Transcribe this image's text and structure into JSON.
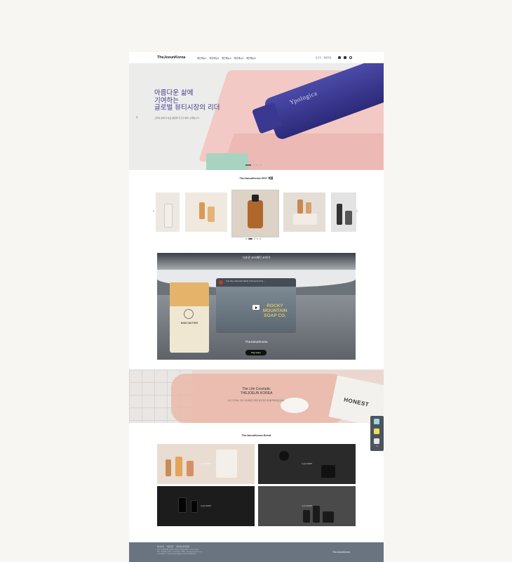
{
  "header": {
    "logo": "TheJoeunKorea",
    "nav": [
      "메인메뉴1",
      "메인메뉴2",
      "메인메뉴3",
      "메인메뉴4",
      "메인메뉴5"
    ],
    "util": [
      "로그인",
      "회원가입"
    ]
  },
  "hero": {
    "headline": [
      "아름다운 삶에",
      "기여하는",
      "글로벌 뷰티시장의 리더"
    ],
    "subtext": "고객의 삶에 더 높은 품질을 추구할 뷰티 소재입니다.",
    "product_text": "Ypologica",
    "slides": 4,
    "active_slide": 1
  },
  "hot": {
    "title": "TheJoeunKorea HOT 제품",
    "pages": 5,
    "active_page": 1
  },
  "video": {
    "title": "더조은 코스메틱 코리아",
    "tabs": [
      "",
      "",
      ""
    ],
    "player_title": "Feel Like a Mountain Watch & Moments at the ...",
    "brand": "ROCKY MOUNTAIN SOAP CO.",
    "product_label": "BODY BUTTER",
    "corp": "TheJoeunKorea",
    "button": "Play Video"
  },
  "banner": {
    "line1": "The Life Cosmetic",
    "line2": "THEJOEUN KOREA",
    "sub": "더조은코리아는 뷰티 소재 제품을 행복한 삶과 좋은 피부를 위해 제공합니다.",
    "product": "HONEST"
  },
  "event": {
    "title": "TheJoeunKorea Event",
    "items": [
      {
        "tag": "더조은 EVENT",
        "bg": "#e8ddd0"
      },
      {
        "tag": "더조은 EVENT",
        "bg": "#2a2a2a"
      },
      {
        "tag": "더조은 EVENT",
        "bg": "#1c1c1c"
      },
      {
        "tag": "더조은 EVENT",
        "bg": "#4a4a4a"
      }
    ]
  },
  "footer": {
    "links": [
      "회사소개",
      "이용약관",
      "개인정보처리방침"
    ],
    "info": [
      "상호 : 더조은코리아 | 대표자 : 홍길동 | 사업자등록번호 : 000-00-00000",
      "주소 : 서울특별시 | 전화 : 02-000-0000 | 이메일 : info@thejoeunkorea.com",
      "COPYRIGHT © THEJOEUNKOREA ALL RIGHTS RESERVED."
    ],
    "logo": "TheJoeunKorea"
  },
  "quickbar": {
    "labels": [
      "",
      "",
      "TOP"
    ]
  },
  "colors": {
    "brand_purple": "#3b3a8d",
    "footer_bg": "#6a7480",
    "page_bg": "#f7f6f3"
  }
}
